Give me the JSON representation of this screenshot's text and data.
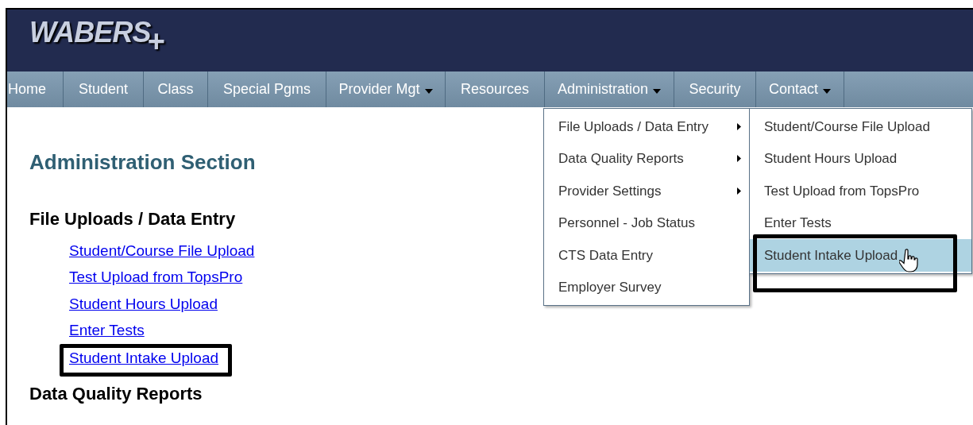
{
  "logo": {
    "text": "WABERS",
    "mark": "+"
  },
  "nav": [
    {
      "label": "Home",
      "has_dropdown": false
    },
    {
      "label": "Student",
      "has_dropdown": false
    },
    {
      "label": "Class",
      "has_dropdown": false
    },
    {
      "label": "Special Pgms",
      "has_dropdown": false
    },
    {
      "label": "Provider Mgt",
      "has_dropdown": true
    },
    {
      "label": "Resources",
      "has_dropdown": false
    },
    {
      "label": "Administration",
      "has_dropdown": true
    },
    {
      "label": "Security",
      "has_dropdown": false
    },
    {
      "label": "Contact",
      "has_dropdown": true
    }
  ],
  "menu": [
    {
      "label": "File Uploads / Data Entry",
      "has_submenu": true
    },
    {
      "label": "Data Quality Reports",
      "has_submenu": true
    },
    {
      "label": "Provider Settings",
      "has_submenu": true
    },
    {
      "label": "Personnel - Job Status",
      "has_submenu": false
    },
    {
      "label": "CTS Data Entry",
      "has_submenu": false
    },
    {
      "label": "Employer Survey",
      "has_submenu": false
    }
  ],
  "submenu": [
    {
      "label": "Student/Course File Upload",
      "selected": false
    },
    {
      "label": "Student Hours Upload",
      "selected": false
    },
    {
      "label": "Test Upload from TopsPro",
      "selected": false
    },
    {
      "label": "Enter Tests",
      "selected": false
    },
    {
      "label": "Student Intake Upload",
      "selected": true
    }
  ],
  "page_title": "Administration Section",
  "sections": [
    {
      "heading": "File Uploads / Data Entry",
      "links": [
        {
          "label": "Student/Course File Upload",
          "highlighted": false
        },
        {
          "label": "Test Upload from TopsPro",
          "highlighted": false
        },
        {
          "label": "Student Hours Upload",
          "highlighted": false
        },
        {
          "label": "Enter Tests",
          "highlighted": false
        },
        {
          "label": "Student Intake Upload",
          "highlighted": true
        }
      ]
    },
    {
      "heading": "Data Quality Reports"
    }
  ]
}
